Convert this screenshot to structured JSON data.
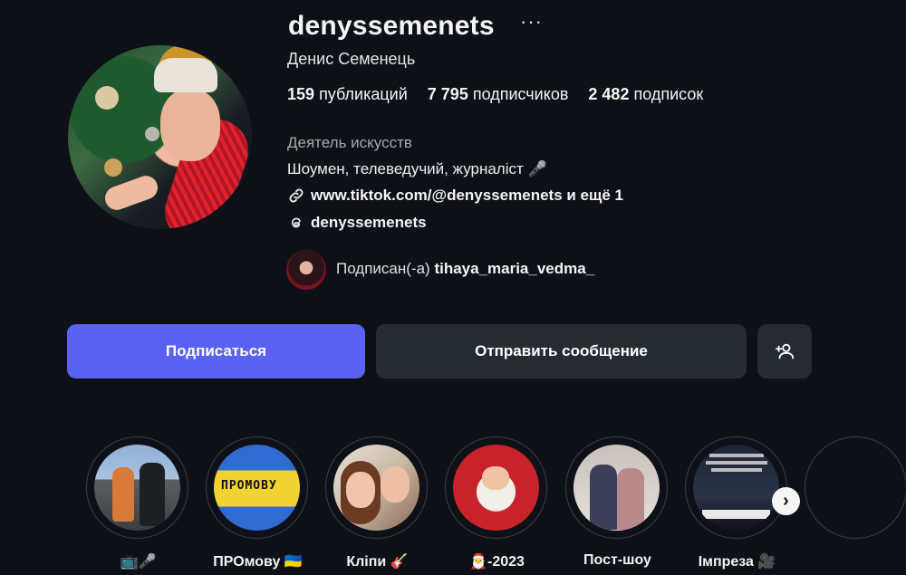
{
  "profile": {
    "username": "denyssemenets",
    "more_icon": "more-horizontal-icon",
    "full_name": "Денис Семенець",
    "stats": {
      "posts_value": "159",
      "posts_label": "публикаций",
      "followers_value": "7 795",
      "followers_label": "подписчиков",
      "following_value": "2 482",
      "following_label": "подписок"
    },
    "category": "Деятель искусств",
    "bio": "Шоумен, телеведучий, журналіст 🎤",
    "link": "www.tiktok.com/@denyssemenets и ещё 1",
    "threads": "denyssemenets",
    "followed_by_prefix": "Подписан(-а)",
    "followed_by_user": "tihaya_maria_vedma_"
  },
  "actions": {
    "follow": "Подписаться",
    "message": "Отправить сообщение",
    "add_icon": "add-person-icon"
  },
  "highlights": [
    {
      "label": "📺🎤"
    },
    {
      "label": "ПРОмову 🇺🇦",
      "cover_text": "ПРОМОВУ"
    },
    {
      "label": "Кліпи 🎸"
    },
    {
      "label": "🎅-2023"
    },
    {
      "label": "Пост-шоу"
    },
    {
      "label": "Імпреза 🎥"
    }
  ],
  "colors": {
    "background": "#0d1016",
    "follow_button": "#5b62f3",
    "secondary_button": "#262a31"
  }
}
